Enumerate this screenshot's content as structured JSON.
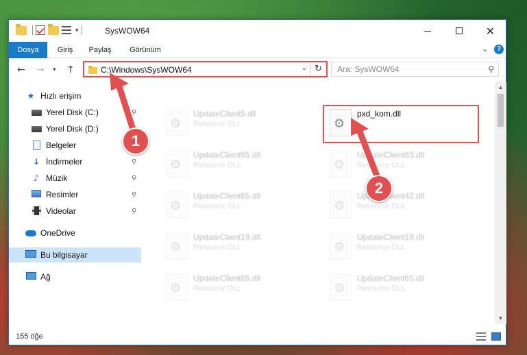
{
  "window": {
    "title": "SysWOW64"
  },
  "ribbon": {
    "tabs": [
      "Dosya",
      "Giriş",
      "Paylaş",
      "Görünüm"
    ]
  },
  "navigation": {
    "address_path": "C:\\Windows\\SysWOW64",
    "search_placeholder": "Ara: SysWOW64"
  },
  "sidebar": {
    "items": [
      {
        "label": "Hızlı erişim",
        "icon": "star-icon",
        "pinned": false
      },
      {
        "label": "Yerel Disk (C:)",
        "icon": "disk-icon",
        "pinned": true
      },
      {
        "label": "Yerel Disk (D:)",
        "icon": "disk-icon",
        "pinned": true
      },
      {
        "label": "Belgeler",
        "icon": "documents-icon",
        "pinned": true
      },
      {
        "label": "İndirmeler",
        "icon": "downloads-icon",
        "pinned": true
      },
      {
        "label": "Müzik",
        "icon": "music-icon",
        "pinned": true
      },
      {
        "label": "Resimler",
        "icon": "pictures-icon",
        "pinned": true
      },
      {
        "label": "Videolar",
        "icon": "videos-icon",
        "pinned": true
      },
      {
        "label": "OneDrive",
        "icon": "cloud-icon",
        "pinned": false
      },
      {
        "label": "Bu bilgisayar",
        "icon": "computer-icon",
        "pinned": false,
        "selected": true
      },
      {
        "label": "Ağ",
        "icon": "network-icon",
        "pinned": false
      }
    ]
  },
  "files": [
    {
      "name": "UpdateClient5.dll",
      "type": "Resource DLL",
      "faded": true
    },
    {
      "name": "pxd_kom.dll",
      "type": "",
      "faded": false,
      "highlighted": true
    },
    {
      "name": "UpdateClient65.dll",
      "type": "Resource DLL",
      "faded": true
    },
    {
      "name": "UpdateClient63.dll",
      "type": "Resource DLL",
      "faded": true
    },
    {
      "name": "UpdateClient65.dll",
      "type": "Resource DLL",
      "faded": true
    },
    {
      "name": "UpdateClient42.dll",
      "type": "Resource DLL",
      "faded": true
    },
    {
      "name": "UpdateClient19.dll",
      "type": "Resource DLL",
      "faded": true
    },
    {
      "name": "UpdateClient19.dll",
      "type": "Resource DLL",
      "faded": true
    },
    {
      "name": "UpdateClient65.dll",
      "type": "Resource DLL",
      "faded": true
    },
    {
      "name": "UpdateClient65.dll",
      "type": "Resource DLL",
      "faded": true
    }
  ],
  "status": {
    "item_count": "155 öğe"
  },
  "annotations": {
    "badge1": "1",
    "badge2": "2",
    "color": "#e05050"
  },
  "colors": {
    "accent": "#1979ca",
    "highlight": "#e05050",
    "selected_bg": "#cce4f7"
  }
}
